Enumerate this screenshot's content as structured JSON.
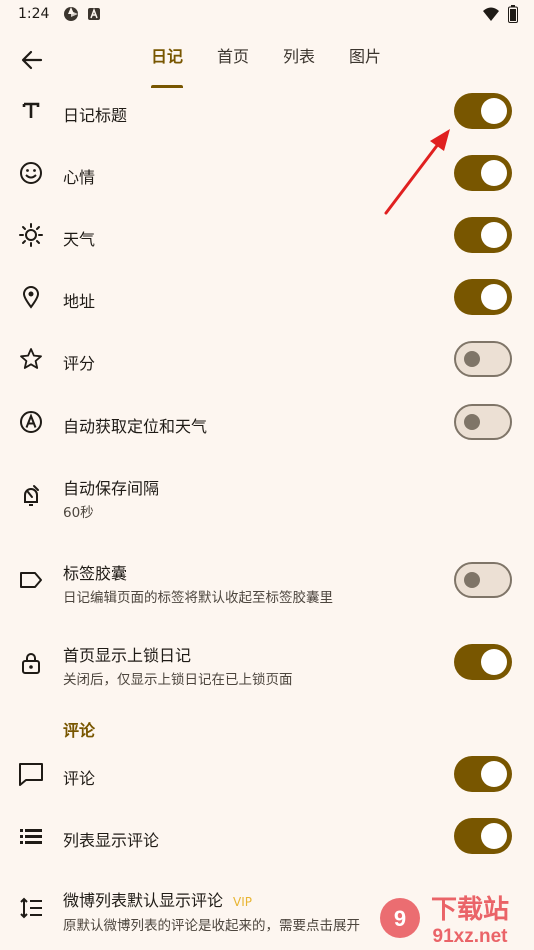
{
  "status_bar": {
    "time": "1:24"
  },
  "top_bar": {
    "tabs": [
      {
        "label": "日记",
        "active": true
      },
      {
        "label": "首页",
        "active": false
      },
      {
        "label": "列表",
        "active": false
      },
      {
        "label": "图片",
        "active": false
      }
    ]
  },
  "settings": [
    {
      "icon": "title-icon",
      "title": "日记标题",
      "subtitle": "",
      "enabled": true
    },
    {
      "icon": "mood-icon",
      "title": "心情",
      "subtitle": "",
      "enabled": true
    },
    {
      "icon": "weather-icon",
      "title": "天气",
      "subtitle": "",
      "enabled": true
    },
    {
      "icon": "location-icon",
      "title": "地址",
      "subtitle": "",
      "enabled": true
    },
    {
      "icon": "star-icon",
      "title": "评分",
      "subtitle": "",
      "enabled": false
    },
    {
      "icon": "auto-location-icon",
      "title": "自动获取定位和天气",
      "subtitle": "",
      "enabled": false
    },
    {
      "icon": "alarm-icon",
      "title": "自动保存间隔",
      "subtitle": "60秒"
    },
    {
      "icon": "label-icon",
      "title": "标签胶囊",
      "subtitle": "日记编辑页面的标签将默认收起至标签胶囊里",
      "enabled": false
    },
    {
      "icon": "lock-icon",
      "title": "首页显示上锁日记",
      "subtitle": "关闭后，仅显示上锁日记在已上锁页面",
      "enabled": true
    }
  ],
  "comments_section": {
    "header": "评论",
    "items": [
      {
        "icon": "comment-icon",
        "title": "评论",
        "enabled": true
      },
      {
        "icon": "list-icon",
        "title": "列表显示评论",
        "enabled": true
      },
      {
        "icon": "line-spacing-icon",
        "title": "微博列表默认显示评论",
        "badge": "VIP",
        "subtitle": "原默认微博列表的评论是收起来的，需要点击展开"
      }
    ]
  },
  "watermark": {
    "brand": "下载站",
    "domain": "91xz.net"
  },
  "colors": {
    "accent": "#785600",
    "background": "#fdf6f0",
    "switch_off": "#ece0d4",
    "vip": "#e8b533",
    "annotation": "#e02020"
  }
}
